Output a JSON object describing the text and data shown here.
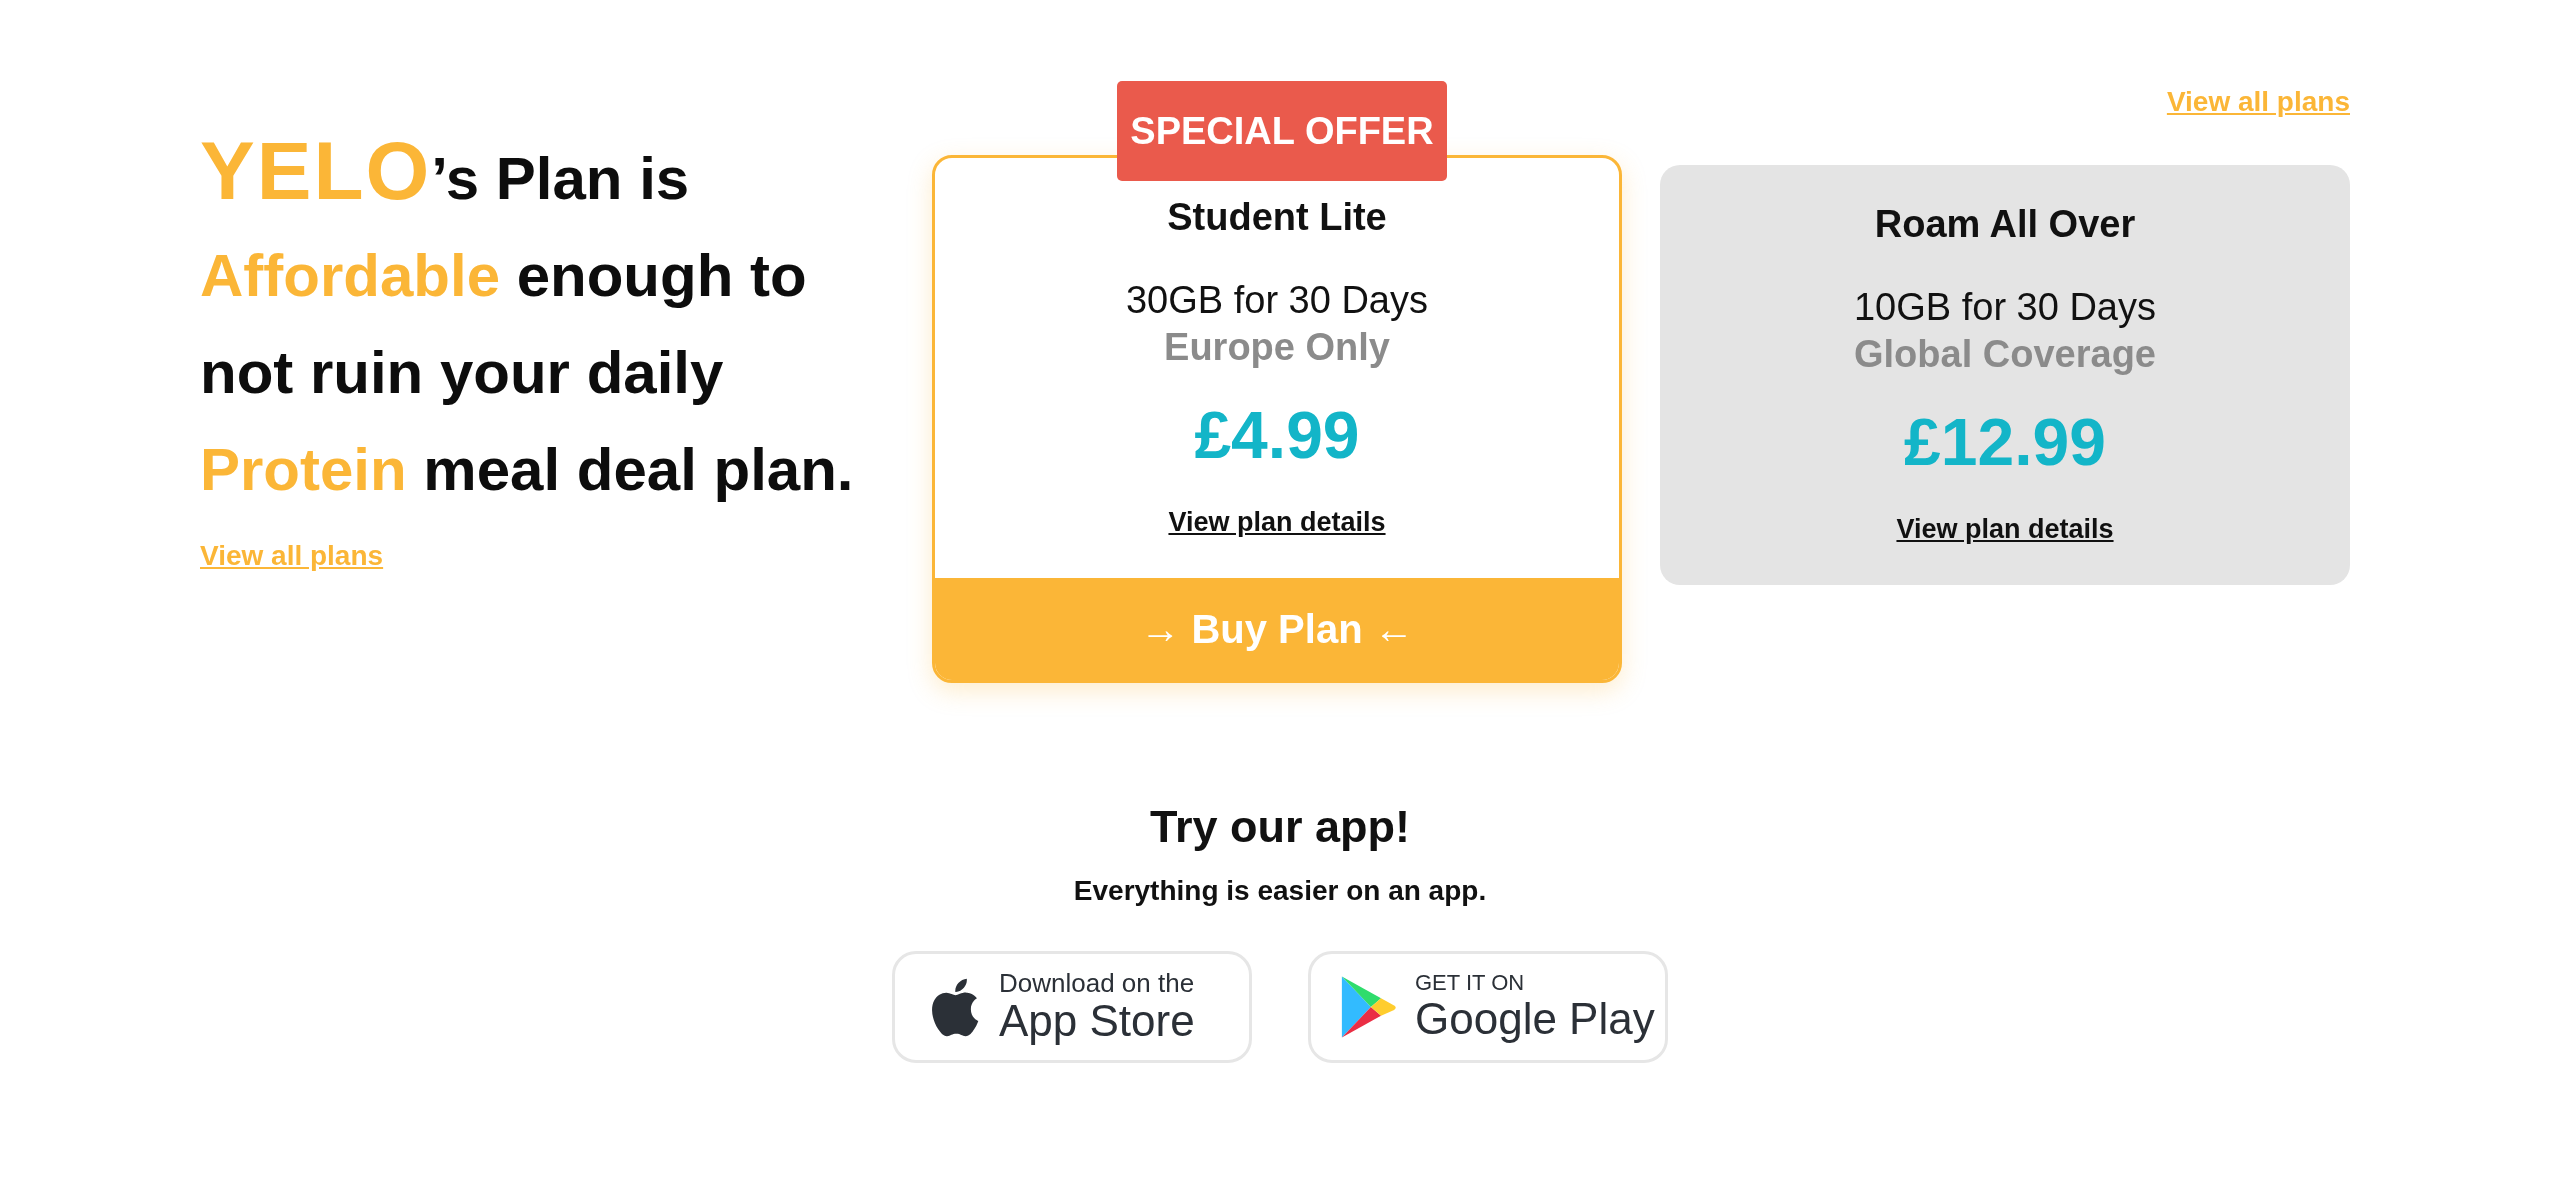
{
  "hero": {
    "logo": "YELO",
    "headline": [
      {
        "text": "’s Plan is ",
        "accent": false
      },
      {
        "text": "Affordable",
        "accent": true
      },
      {
        "text": " enough to not ruin your daily ",
        "accent": false
      },
      {
        "text": "Protein",
        "accent": true
      },
      {
        "text": " meal deal plan.",
        "accent": false
      }
    ],
    "link": "View all plans"
  },
  "plans_link": "View all plans",
  "plans": [
    {
      "badge": "SPECIAL OFFER",
      "name": "Student Lite",
      "data": "30GB for 30 Days",
      "coverage": "Europe Only",
      "price": "£4.99",
      "details_link": "View plan details",
      "buy_button": "→ Buy Plan ←",
      "featured": true
    },
    {
      "name": "Roam All Over",
      "data": "10GB for 30 Days",
      "coverage": "Global Coverage",
      "price": "£12.99",
      "details_link": "View plan details",
      "featured": false
    }
  ],
  "app": {
    "title": "Try our app!",
    "subtitle": "Everything is easier on an app.",
    "stores": [
      {
        "kind": "apple",
        "caption": "Download on the",
        "name": "App Store"
      },
      {
        "kind": "google",
        "caption": "GET IT ON",
        "name": "Google Play"
      }
    ]
  }
}
